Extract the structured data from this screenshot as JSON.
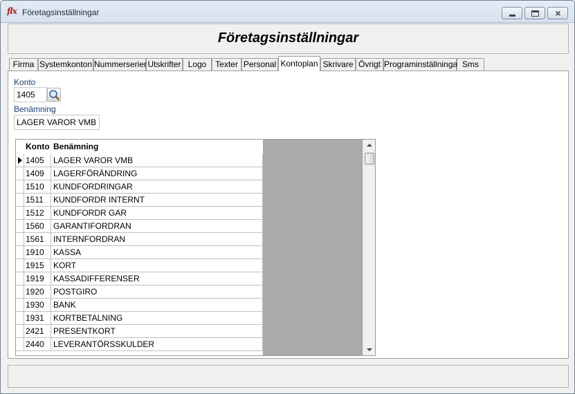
{
  "window": {
    "icon_text": "flx",
    "title": "Företagsinställningar",
    "minimize_symbol": "",
    "close_symbol": "×"
  },
  "header": {
    "title": "Företagsinställningar"
  },
  "tabs": [
    {
      "label": "Firma",
      "active": false
    },
    {
      "label": "Systemkonton",
      "active": false
    },
    {
      "label": "Nummerserier",
      "active": false
    },
    {
      "label": "Utskrifter",
      "active": false
    },
    {
      "label": "Logo",
      "active": false
    },
    {
      "label": "Texter",
      "active": false
    },
    {
      "label": "Personal",
      "active": false
    },
    {
      "label": "Kontoplan",
      "active": true
    },
    {
      "label": "Skrivare",
      "active": false
    },
    {
      "label": "Övrigt",
      "active": false
    },
    {
      "label": "Programinställningar",
      "active": false
    },
    {
      "label": "Sms",
      "active": false
    }
  ],
  "form": {
    "konto_label": "Konto",
    "konto_value": "1405",
    "benamning_label": "Benämning",
    "benamning_value": "LAGER VAROR VMB"
  },
  "grid": {
    "columns": [
      "Konto",
      "Benämning"
    ],
    "selected_index": 0,
    "rows": [
      {
        "konto": "1405",
        "benamning": "LAGER VAROR VMB"
      },
      {
        "konto": "1409",
        "benamning": "LAGERFÖRÄNDRING"
      },
      {
        "konto": "1510",
        "benamning": "KUNDFORDRINGAR"
      },
      {
        "konto": "1511",
        "benamning": "KUNDFORDR INTERNT"
      },
      {
        "konto": "1512",
        "benamning": "KUNDFORDR GAR"
      },
      {
        "konto": "1560",
        "benamning": "GARANTIFORDRAN"
      },
      {
        "konto": "1561",
        "benamning": "INTERNFORDRAN"
      },
      {
        "konto": "1910",
        "benamning": "KASSA"
      },
      {
        "konto": "1915",
        "benamning": "KORT"
      },
      {
        "konto": "1919",
        "benamning": "KASSADIFFERENSER"
      },
      {
        "konto": "1920",
        "benamning": "POSTGIRO"
      },
      {
        "konto": "1930",
        "benamning": "BANK"
      },
      {
        "konto": "1931",
        "benamning": "KORTBETALNING"
      },
      {
        "konto": "2421",
        "benamning": "PRESENTKORT"
      },
      {
        "konto": "2440",
        "benamning": "LEVERANTÖRSSKULDER"
      }
    ]
  }
}
